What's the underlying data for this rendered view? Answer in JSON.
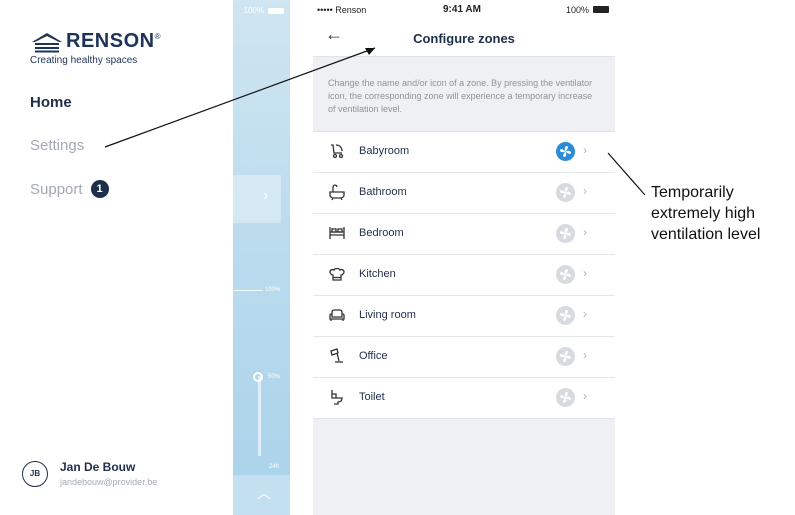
{
  "menu": {
    "brand": "RENSON",
    "brand_mark": "®",
    "tagline": "Creating healthy spaces",
    "items": [
      {
        "label": "Home"
      },
      {
        "label": "Settings"
      },
      {
        "label": "Support",
        "badge": "1"
      }
    ],
    "user": {
      "initials": "JB",
      "name": "Jan De Bouw",
      "email": "jandebouw@provider.be"
    }
  },
  "peek": {
    "battery": "100%",
    "level_a": "100%",
    "level_b": "50%",
    "level_c": "24h"
  },
  "phone": {
    "status": {
      "carrier": "••••• Renson",
      "time": "9:41 AM",
      "battery": "100%"
    },
    "title": "Configure zones",
    "description": "Change the name and/or icon of a zone. By pressing the ventilator icon, the corresponding zone will experience a temporary increase of ventilation level.",
    "zones": [
      {
        "name": "Babyroom",
        "icon": "stroller-icon",
        "active": true
      },
      {
        "name": "Bathroom",
        "icon": "bathtub-icon",
        "active": false
      },
      {
        "name": "Bedroom",
        "icon": "bed-icon",
        "active": false
      },
      {
        "name": "Kitchen",
        "icon": "chef-hat-icon",
        "active": false
      },
      {
        "name": "Living room",
        "icon": "sofa-icon",
        "active": false
      },
      {
        "name": "Office",
        "icon": "desk-lamp-icon",
        "active": false
      },
      {
        "name": "Toilet",
        "icon": "toilet-icon",
        "active": false
      }
    ]
  },
  "annotation": {
    "line1": "Temporarily",
    "line2": "extremely high",
    "line3": "ventilation level"
  },
  "colors": {
    "navy": "#1e2f4a",
    "accent_blue": "#2a8bd8",
    "inactive_fan": "#d7dbe0"
  }
}
